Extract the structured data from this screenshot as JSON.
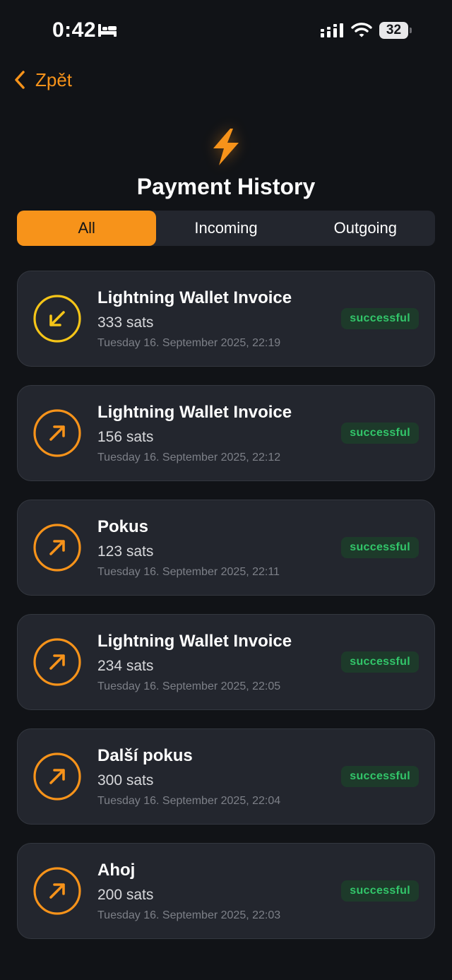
{
  "status_bar": {
    "time": "0:42",
    "battery": "32"
  },
  "nav": {
    "back_label": "Zpět"
  },
  "header": {
    "title": "Payment History"
  },
  "tabs": [
    {
      "label": "All",
      "active": true
    },
    {
      "label": "Incoming",
      "active": false
    },
    {
      "label": "Outgoing",
      "active": false
    }
  ],
  "colors": {
    "accent": "#f7931a",
    "incoming": "#f5c518",
    "success_text": "#32c66a",
    "success_bg": "#1d3a2a",
    "background": "#111317",
    "card": "#23262e"
  },
  "payments": [
    {
      "title": "Lightning Wallet Invoice",
      "amount": "333 sats",
      "date": "Tuesday 16. September 2025, 22:19",
      "status": "successful",
      "direction": "incoming",
      "icon": "arrow-down-left-icon"
    },
    {
      "title": "Lightning Wallet Invoice",
      "amount": "156 sats",
      "date": "Tuesday 16. September 2025, 22:12",
      "status": "successful",
      "direction": "outgoing",
      "icon": "arrow-up-right-icon"
    },
    {
      "title": "Pokus",
      "amount": "123 sats",
      "date": "Tuesday 16. September 2025, 22:11",
      "status": "successful",
      "direction": "outgoing",
      "icon": "arrow-up-right-icon"
    },
    {
      "title": "Lightning Wallet Invoice",
      "amount": "234 sats",
      "date": "Tuesday 16. September 2025, 22:05",
      "status": "successful",
      "direction": "outgoing",
      "icon": "arrow-up-right-icon"
    },
    {
      "title": "Další pokus",
      "amount": "300 sats",
      "date": "Tuesday 16. September 2025, 22:04",
      "status": "successful",
      "direction": "outgoing",
      "icon": "arrow-up-right-icon"
    },
    {
      "title": "Ahoj",
      "amount": "200 sats",
      "date": "Tuesday 16. September 2025, 22:03",
      "status": "successful",
      "direction": "outgoing",
      "icon": "arrow-up-right-icon"
    }
  ]
}
